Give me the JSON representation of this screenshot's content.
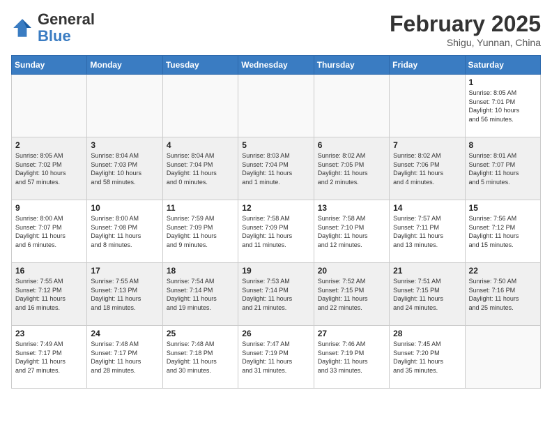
{
  "logo": {
    "general": "General",
    "blue": "Blue"
  },
  "title": "February 2025",
  "subtitle": "Shigu, Yunnan, China",
  "days_of_week": [
    "Sunday",
    "Monday",
    "Tuesday",
    "Wednesday",
    "Thursday",
    "Friday",
    "Saturday"
  ],
  "weeks": [
    [
      {
        "day": "",
        "info": ""
      },
      {
        "day": "",
        "info": ""
      },
      {
        "day": "",
        "info": ""
      },
      {
        "day": "",
        "info": ""
      },
      {
        "day": "",
        "info": ""
      },
      {
        "day": "",
        "info": ""
      },
      {
        "day": "1",
        "info": "Sunrise: 8:05 AM\nSunset: 7:01 PM\nDaylight: 10 hours\nand 56 minutes."
      }
    ],
    [
      {
        "day": "2",
        "info": "Sunrise: 8:05 AM\nSunset: 7:02 PM\nDaylight: 10 hours\nand 57 minutes."
      },
      {
        "day": "3",
        "info": "Sunrise: 8:04 AM\nSunset: 7:03 PM\nDaylight: 10 hours\nand 58 minutes."
      },
      {
        "day": "4",
        "info": "Sunrise: 8:04 AM\nSunset: 7:04 PM\nDaylight: 11 hours\nand 0 minutes."
      },
      {
        "day": "5",
        "info": "Sunrise: 8:03 AM\nSunset: 7:04 PM\nDaylight: 11 hours\nand 1 minute."
      },
      {
        "day": "6",
        "info": "Sunrise: 8:02 AM\nSunset: 7:05 PM\nDaylight: 11 hours\nand 2 minutes."
      },
      {
        "day": "7",
        "info": "Sunrise: 8:02 AM\nSunset: 7:06 PM\nDaylight: 11 hours\nand 4 minutes."
      },
      {
        "day": "8",
        "info": "Sunrise: 8:01 AM\nSunset: 7:07 PM\nDaylight: 11 hours\nand 5 minutes."
      }
    ],
    [
      {
        "day": "9",
        "info": "Sunrise: 8:00 AM\nSunset: 7:07 PM\nDaylight: 11 hours\nand 6 minutes."
      },
      {
        "day": "10",
        "info": "Sunrise: 8:00 AM\nSunset: 7:08 PM\nDaylight: 11 hours\nand 8 minutes."
      },
      {
        "day": "11",
        "info": "Sunrise: 7:59 AM\nSunset: 7:09 PM\nDaylight: 11 hours\nand 9 minutes."
      },
      {
        "day": "12",
        "info": "Sunrise: 7:58 AM\nSunset: 7:09 PM\nDaylight: 11 hours\nand 11 minutes."
      },
      {
        "day": "13",
        "info": "Sunrise: 7:58 AM\nSunset: 7:10 PM\nDaylight: 11 hours\nand 12 minutes."
      },
      {
        "day": "14",
        "info": "Sunrise: 7:57 AM\nSunset: 7:11 PM\nDaylight: 11 hours\nand 13 minutes."
      },
      {
        "day": "15",
        "info": "Sunrise: 7:56 AM\nSunset: 7:12 PM\nDaylight: 11 hours\nand 15 minutes."
      }
    ],
    [
      {
        "day": "16",
        "info": "Sunrise: 7:55 AM\nSunset: 7:12 PM\nDaylight: 11 hours\nand 16 minutes."
      },
      {
        "day": "17",
        "info": "Sunrise: 7:55 AM\nSunset: 7:13 PM\nDaylight: 11 hours\nand 18 minutes."
      },
      {
        "day": "18",
        "info": "Sunrise: 7:54 AM\nSunset: 7:14 PM\nDaylight: 11 hours\nand 19 minutes."
      },
      {
        "day": "19",
        "info": "Sunrise: 7:53 AM\nSunset: 7:14 PM\nDaylight: 11 hours\nand 21 minutes."
      },
      {
        "day": "20",
        "info": "Sunrise: 7:52 AM\nSunset: 7:15 PM\nDaylight: 11 hours\nand 22 minutes."
      },
      {
        "day": "21",
        "info": "Sunrise: 7:51 AM\nSunset: 7:15 PM\nDaylight: 11 hours\nand 24 minutes."
      },
      {
        "day": "22",
        "info": "Sunrise: 7:50 AM\nSunset: 7:16 PM\nDaylight: 11 hours\nand 25 minutes."
      }
    ],
    [
      {
        "day": "23",
        "info": "Sunrise: 7:49 AM\nSunset: 7:17 PM\nDaylight: 11 hours\nand 27 minutes."
      },
      {
        "day": "24",
        "info": "Sunrise: 7:48 AM\nSunset: 7:17 PM\nDaylight: 11 hours\nand 28 minutes."
      },
      {
        "day": "25",
        "info": "Sunrise: 7:48 AM\nSunset: 7:18 PM\nDaylight: 11 hours\nand 30 minutes."
      },
      {
        "day": "26",
        "info": "Sunrise: 7:47 AM\nSunset: 7:19 PM\nDaylight: 11 hours\nand 31 minutes."
      },
      {
        "day": "27",
        "info": "Sunrise: 7:46 AM\nSunset: 7:19 PM\nDaylight: 11 hours\nand 33 minutes."
      },
      {
        "day": "28",
        "info": "Sunrise: 7:45 AM\nSunset: 7:20 PM\nDaylight: 11 hours\nand 35 minutes."
      },
      {
        "day": "",
        "info": ""
      }
    ]
  ]
}
